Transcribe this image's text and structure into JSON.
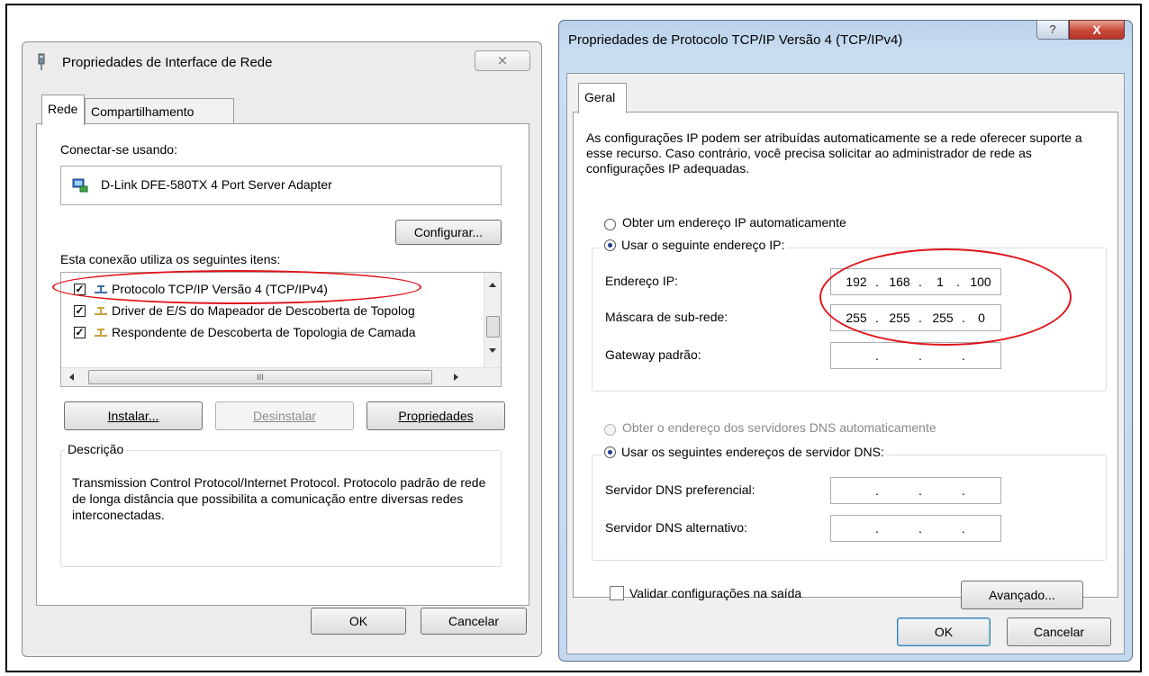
{
  "left_dialog": {
    "title": "Propriedades de Interface de Rede",
    "close_glyph": "⨯",
    "tabs": [
      "Rede",
      "Compartilhamento"
    ],
    "connect_using_label": "Conectar-se usando:",
    "adapter_name": "D-Link DFE-580TX 4 Port Server Adapter",
    "configure_button": "Configurar...",
    "items_label": "Esta conexão utiliza os seguintes itens:",
    "items": [
      {
        "label": "Protocolo TCP/IP Versão 4 (TCP/IPv4)",
        "checked": true
      },
      {
        "label": "Driver de E/S do Mapeador de Descoberta de Topolog",
        "checked": true
      },
      {
        "label": "Respondente de Descoberta de Topologia de Camada",
        "checked": true
      }
    ],
    "hscroll_thumb_glyph": "III",
    "install_button": "Instalar...",
    "uninstall_button": "Desinstalar",
    "properties_button": "Propriedades",
    "description_group": "Descrição",
    "description_text": "Transmission Control Protocol/Internet Protocol. Protocolo padrão de rede de longa distância que possibilita a comunicação entre diversas redes interconectadas.",
    "ok_button": "OK",
    "cancel_button": "Cancelar"
  },
  "right_dialog": {
    "title": "Propriedades de Protocolo TCP/IP Versão 4 (TCP/IPv4)",
    "help_glyph": "?",
    "close_glyph": "X",
    "tab": "Geral",
    "intro_text": "As configurações IP podem ser atribuídas automaticamente se a rede oferecer suporte a esse recurso. Caso contrário, você precisa solicitar ao administrador de rede as configurações IP adequadas.",
    "radio_auto_ip": "Obter um endereço IP automaticamente",
    "radio_manual_ip": "Usar o seguinte endereço IP:",
    "ip_label": "Endereço IP:",
    "ip_value": [
      "192",
      "168",
      "1",
      "100"
    ],
    "mask_label": "Máscara de sub-rede:",
    "mask_value": [
      "255",
      "255",
      "255",
      "0"
    ],
    "gateway_label": "Gateway padrão:",
    "radio_auto_dns": "Obter o endereço dos servidores DNS automaticamente",
    "radio_manual_dns": "Usar os seguintes endereços de servidor DNS:",
    "dns_pref_label": "Servidor DNS preferencial:",
    "dns_alt_label": "Servidor DNS alternativo:",
    "validate_label": "Validar configurações na saída",
    "advanced_button": "Avançado...",
    "ok_button": "OK",
    "cancel_button": "Cancelar"
  },
  "colors": {
    "highlight_ellipse": "#e0141b",
    "right_frame": "#c4d9ef"
  }
}
